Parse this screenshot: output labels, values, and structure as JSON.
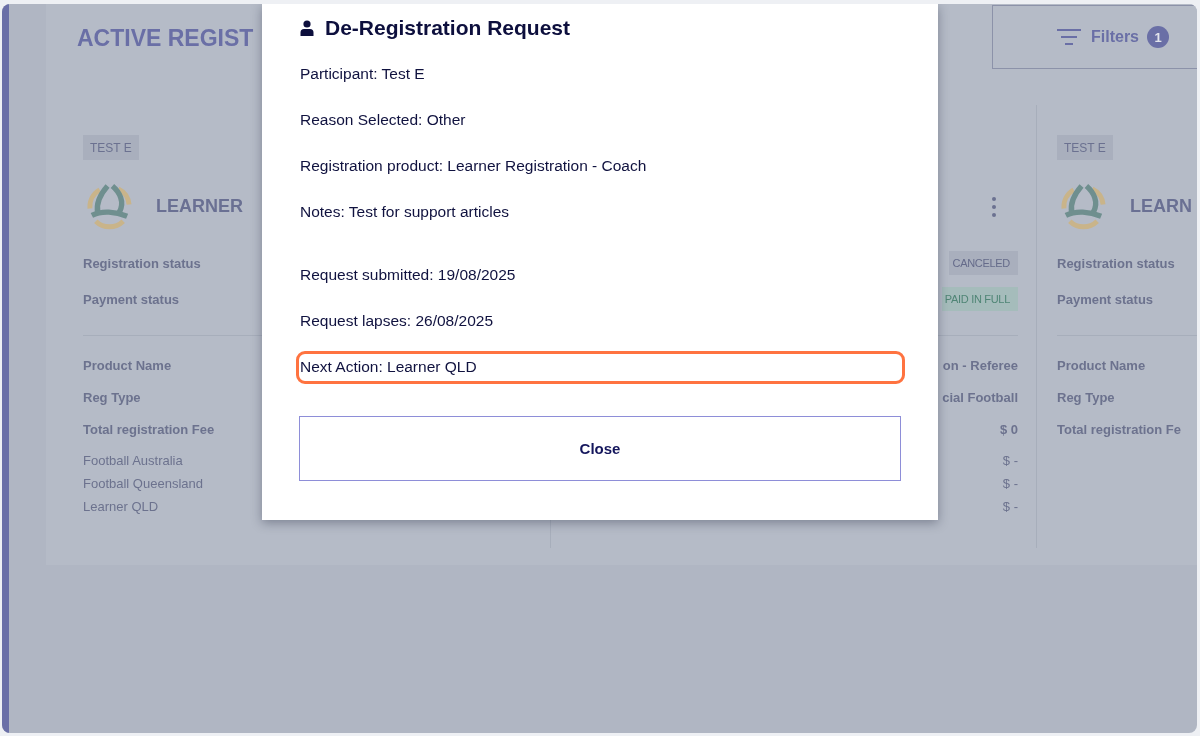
{
  "page": {
    "title": "ACTIVE REGIST",
    "filters": {
      "label": "Filters",
      "count": "1"
    }
  },
  "cards": [
    {
      "tag": "TEST E",
      "title": "LEARNER",
      "status_rows": [
        {
          "label": "Registration status"
        },
        {
          "label": "Payment status"
        }
      ],
      "detail_rows": [
        {
          "label": "Product Name"
        },
        {
          "label": "Reg Type"
        },
        {
          "label": "Total registration Fee"
        }
      ],
      "fee_rows": [
        {
          "label": "Football Australia"
        },
        {
          "label": "Football Queensland"
        },
        {
          "label": "Learner QLD"
        }
      ]
    },
    {
      "menu": true,
      "status_rows": [
        {
          "value": "CANCELED",
          "kind": "neutral"
        },
        {
          "value": "PAID IN FULL",
          "kind": "success"
        }
      ],
      "detail_rows": [
        {
          "value": "on - Referee"
        },
        {
          "value": "cial Football"
        },
        {
          "value": "$ 0"
        }
      ],
      "fee_rows": [
        {
          "value": "$ -"
        },
        {
          "value": "$ -"
        },
        {
          "value": "$ -"
        }
      ]
    },
    {
      "tag": "TEST E",
      "title": "LEARN",
      "status_rows": [
        {
          "label": "Registration status"
        },
        {
          "label": "Payment status"
        }
      ],
      "detail_rows": [
        {
          "label": "Product Name"
        },
        {
          "label": "Reg Type"
        },
        {
          "label": "Total registration Fe"
        }
      ]
    }
  ],
  "dialog": {
    "title": "De-Registration Request",
    "sections": [
      {
        "lines": [
          {
            "text": "Participant: Test E",
            "highlighted": false
          },
          {
            "text": "Reason Selected: Other",
            "highlighted": false
          },
          {
            "text": "Registration product: Learner Registration - Coach",
            "highlighted": false
          },
          {
            "text": "Notes: Test for support articles",
            "highlighted": false
          }
        ]
      },
      {
        "lines": [
          {
            "text": "Request submitted: 19/08/2025",
            "highlighted": false
          },
          {
            "text": "Request lapses: 26/08/2025",
            "highlighted": false
          },
          {
            "text": "Next Action: Learner QLD",
            "highlighted": true
          }
        ]
      }
    ],
    "button": "Close"
  }
}
